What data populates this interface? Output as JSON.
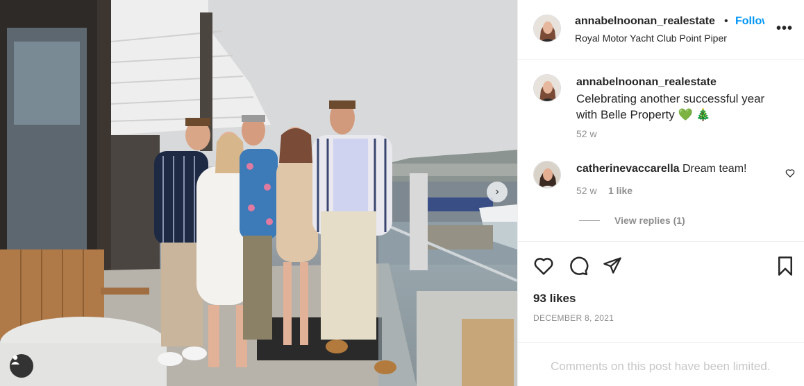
{
  "post": {
    "username": "annabelnoonan_realestate",
    "separator": "•",
    "follow_label": "Follow",
    "location": "Royal Motor Yacht Club Point Piper",
    "more_icon": "more-options-icon",
    "more_label": "•••"
  },
  "caption": {
    "username": "annabelnoonan_realestate",
    "text": "Celebrating another successful year with Belle Property",
    "emoji": "💚 🎄",
    "time": "52 w"
  },
  "comment": {
    "username": "catherinevaccarella",
    "text": "Dream team!",
    "time": "52 w",
    "likes": "1 like",
    "view_replies": "View replies (1)"
  },
  "actions": {
    "likes": "93 likes",
    "date": "DECEMBER 8, 2021",
    "like_icon": "heart-icon",
    "comment_icon": "comment-icon",
    "share_icon": "share-icon",
    "save_icon": "bookmark-icon"
  },
  "footer": {
    "limited": "Comments on this post have been limited."
  },
  "photo": {
    "next_icon": "chevron-right-icon",
    "tag_icon": "user-tag-icon"
  },
  "colors": {
    "link": "#0095f6",
    "text": "#262626",
    "muted": "#8e8e8e",
    "divider": "#efefef"
  }
}
